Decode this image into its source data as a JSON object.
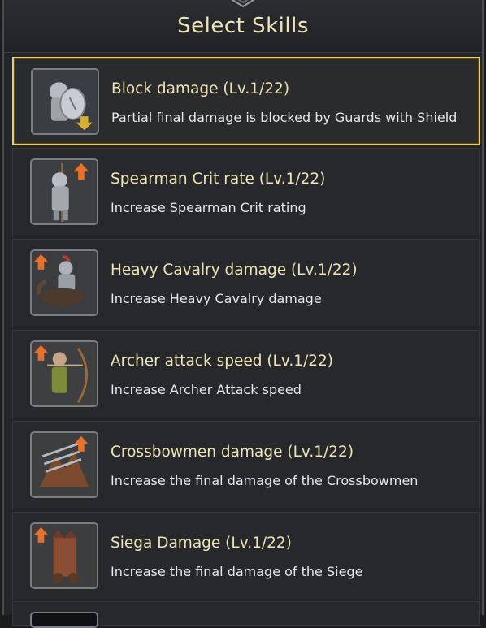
{
  "header": {
    "title": "Select Skills"
  },
  "skills": [
    {
      "name": "Block damage (Lv.1/22)",
      "desc": "Partial final damage is blocked by Guards with Shield",
      "icon": "guard-shield-icon",
      "selected": true
    },
    {
      "name": "Spearman Crit rate (Lv.1/22)",
      "desc": "Increase Spearman Crit rating",
      "icon": "spearman-icon",
      "selected": false
    },
    {
      "name": "Heavy Cavalry damage (Lv.1/22)",
      "desc": "Increase Heavy Cavalry damage",
      "icon": "heavy-cavalry-icon",
      "selected": false
    },
    {
      "name": "Archer attack speed (Lv.1/22)",
      "desc": "Increase Archer Attack speed",
      "icon": "archer-icon",
      "selected": false
    },
    {
      "name": "Crossbowmen damage (Lv.1/22)",
      "desc": "Increase the final damage of the Crossbowmen",
      "icon": "crossbow-icon",
      "selected": false
    },
    {
      "name": "Siega Damage (Lv.1/22)",
      "desc": "Increase the final damage of the Siege",
      "icon": "siege-icon",
      "selected": false
    }
  ],
  "colors": {
    "title": "#efe4b4",
    "selected_border": "#e9cf66",
    "arrow_up": "#e8712a",
    "arrow_down": "#d8b030"
  }
}
